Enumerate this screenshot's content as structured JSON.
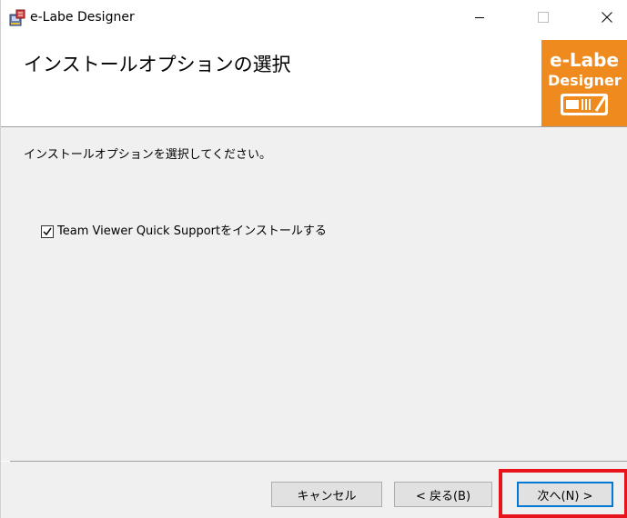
{
  "window": {
    "title": "e-Labe Designer",
    "controls": {
      "minimize": "minimize-icon",
      "maximize": "maximize-icon",
      "close": "close-icon"
    }
  },
  "header": {
    "title": "インストールオプションの選択",
    "logo": {
      "line1": "e-Labe",
      "line2": "Designer",
      "color": "#ef8a1e"
    }
  },
  "body": {
    "instruction": "インストールオプションを選択してください。",
    "option": {
      "label": "Team Viewer Quick Supportをインストールする",
      "checked": true
    }
  },
  "footer": {
    "cancel_label": "キャンセル",
    "back_label": "< 戻る(B)",
    "next_label": "次へ(N) >"
  },
  "highlight": {
    "target": "next-button",
    "color": "#e8141c"
  }
}
